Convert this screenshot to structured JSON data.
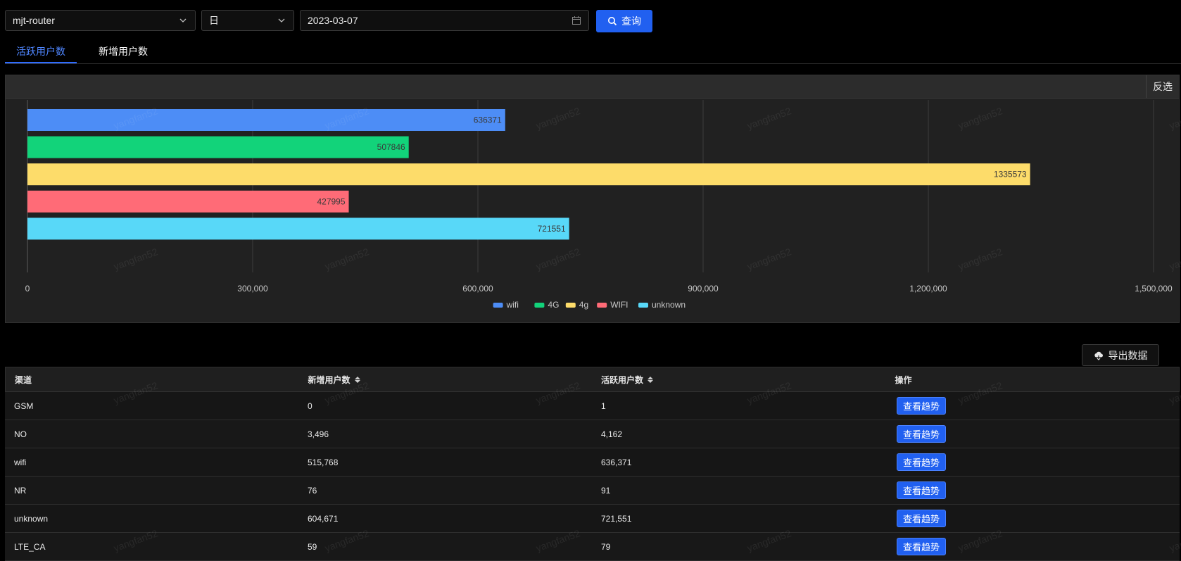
{
  "filters": {
    "app_select": "mjt-router",
    "period_select": "日",
    "date_value": "2023-03-07",
    "query_label": "查询"
  },
  "tabs": [
    {
      "label": "活跃用户数",
      "active": true
    },
    {
      "label": "新增用户数",
      "active": false
    }
  ],
  "chart_panel": {
    "invert_label": "反选"
  },
  "chart_data": {
    "type": "bar",
    "orientation": "horizontal",
    "title": "",
    "xlabel": "",
    "ylabel": "",
    "xlim": [
      0,
      1500000
    ],
    "x_ticks": [
      "0",
      "300,000",
      "600,000",
      "900,000",
      "1,200,000",
      "1,500,000"
    ],
    "grid": true,
    "legend_position": "bottom",
    "series": [
      {
        "name": "wifi",
        "value": 636371,
        "color": "#4d8df6"
      },
      {
        "name": "4G",
        "value": 507846,
        "color": "#12d37a"
      },
      {
        "name": "4g",
        "value": 1335573,
        "color": "#fddc6a"
      },
      {
        "name": "WIFI",
        "value": 427995,
        "color": "#ff6b77"
      },
      {
        "name": "unknown",
        "value": 721551,
        "color": "#58d8f8"
      }
    ]
  },
  "export_label": "导出数据",
  "table": {
    "headers": [
      "渠道",
      "新增用户数",
      "活跃用户数",
      "操作"
    ],
    "action_label": "查看趋势",
    "rows": [
      [
        "GSM",
        "0",
        "1"
      ],
      [
        "NO",
        "3,496",
        "4,162"
      ],
      [
        "wifi",
        "515,768",
        "636,371"
      ],
      [
        "NR",
        "76",
        "91"
      ],
      [
        "unknown",
        "604,671",
        "721,551"
      ],
      [
        "LTE_CA",
        "59",
        "79"
      ]
    ]
  },
  "watermark_text": "yangfan52",
  "colors": {
    "accent": "#2160f0",
    "tab_active": "#4f86ff"
  }
}
